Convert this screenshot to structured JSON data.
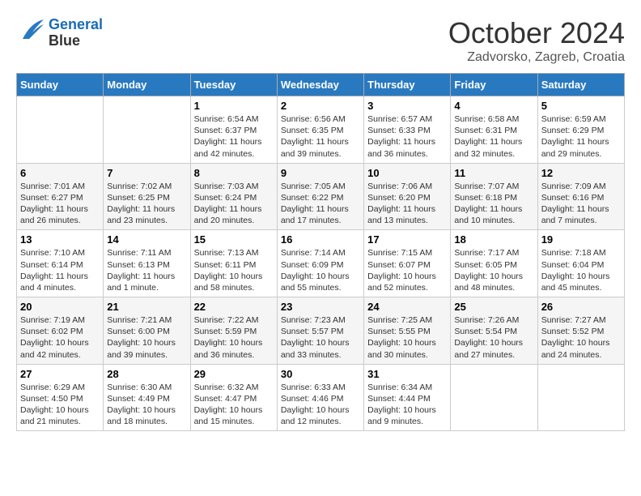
{
  "header": {
    "logo_line1": "General",
    "logo_line2": "Blue",
    "month": "October 2024",
    "location": "Zadvorsko, Zagreb, Croatia"
  },
  "weekdays": [
    "Sunday",
    "Monday",
    "Tuesday",
    "Wednesday",
    "Thursday",
    "Friday",
    "Saturday"
  ],
  "weeks": [
    [
      {
        "day": "",
        "info": ""
      },
      {
        "day": "",
        "info": ""
      },
      {
        "day": "1",
        "info": "Sunrise: 6:54 AM\nSunset: 6:37 PM\nDaylight: 11 hours\nand 42 minutes."
      },
      {
        "day": "2",
        "info": "Sunrise: 6:56 AM\nSunset: 6:35 PM\nDaylight: 11 hours\nand 39 minutes."
      },
      {
        "day": "3",
        "info": "Sunrise: 6:57 AM\nSunset: 6:33 PM\nDaylight: 11 hours\nand 36 minutes."
      },
      {
        "day": "4",
        "info": "Sunrise: 6:58 AM\nSunset: 6:31 PM\nDaylight: 11 hours\nand 32 minutes."
      },
      {
        "day": "5",
        "info": "Sunrise: 6:59 AM\nSunset: 6:29 PM\nDaylight: 11 hours\nand 29 minutes."
      }
    ],
    [
      {
        "day": "6",
        "info": "Sunrise: 7:01 AM\nSunset: 6:27 PM\nDaylight: 11 hours\nand 26 minutes."
      },
      {
        "day": "7",
        "info": "Sunrise: 7:02 AM\nSunset: 6:25 PM\nDaylight: 11 hours\nand 23 minutes."
      },
      {
        "day": "8",
        "info": "Sunrise: 7:03 AM\nSunset: 6:24 PM\nDaylight: 11 hours\nand 20 minutes."
      },
      {
        "day": "9",
        "info": "Sunrise: 7:05 AM\nSunset: 6:22 PM\nDaylight: 11 hours\nand 17 minutes."
      },
      {
        "day": "10",
        "info": "Sunrise: 7:06 AM\nSunset: 6:20 PM\nDaylight: 11 hours\nand 13 minutes."
      },
      {
        "day": "11",
        "info": "Sunrise: 7:07 AM\nSunset: 6:18 PM\nDaylight: 11 hours\nand 10 minutes."
      },
      {
        "day": "12",
        "info": "Sunrise: 7:09 AM\nSunset: 6:16 PM\nDaylight: 11 hours\nand 7 minutes."
      }
    ],
    [
      {
        "day": "13",
        "info": "Sunrise: 7:10 AM\nSunset: 6:14 PM\nDaylight: 11 hours\nand 4 minutes."
      },
      {
        "day": "14",
        "info": "Sunrise: 7:11 AM\nSunset: 6:13 PM\nDaylight: 11 hours\nand 1 minute."
      },
      {
        "day": "15",
        "info": "Sunrise: 7:13 AM\nSunset: 6:11 PM\nDaylight: 10 hours\nand 58 minutes."
      },
      {
        "day": "16",
        "info": "Sunrise: 7:14 AM\nSunset: 6:09 PM\nDaylight: 10 hours\nand 55 minutes."
      },
      {
        "day": "17",
        "info": "Sunrise: 7:15 AM\nSunset: 6:07 PM\nDaylight: 10 hours\nand 52 minutes."
      },
      {
        "day": "18",
        "info": "Sunrise: 7:17 AM\nSunset: 6:05 PM\nDaylight: 10 hours\nand 48 minutes."
      },
      {
        "day": "19",
        "info": "Sunrise: 7:18 AM\nSunset: 6:04 PM\nDaylight: 10 hours\nand 45 minutes."
      }
    ],
    [
      {
        "day": "20",
        "info": "Sunrise: 7:19 AM\nSunset: 6:02 PM\nDaylight: 10 hours\nand 42 minutes."
      },
      {
        "day": "21",
        "info": "Sunrise: 7:21 AM\nSunset: 6:00 PM\nDaylight: 10 hours\nand 39 minutes."
      },
      {
        "day": "22",
        "info": "Sunrise: 7:22 AM\nSunset: 5:59 PM\nDaylight: 10 hours\nand 36 minutes."
      },
      {
        "day": "23",
        "info": "Sunrise: 7:23 AM\nSunset: 5:57 PM\nDaylight: 10 hours\nand 33 minutes."
      },
      {
        "day": "24",
        "info": "Sunrise: 7:25 AM\nSunset: 5:55 PM\nDaylight: 10 hours\nand 30 minutes."
      },
      {
        "day": "25",
        "info": "Sunrise: 7:26 AM\nSunset: 5:54 PM\nDaylight: 10 hours\nand 27 minutes."
      },
      {
        "day": "26",
        "info": "Sunrise: 7:27 AM\nSunset: 5:52 PM\nDaylight: 10 hours\nand 24 minutes."
      }
    ],
    [
      {
        "day": "27",
        "info": "Sunrise: 6:29 AM\nSunset: 4:50 PM\nDaylight: 10 hours\nand 21 minutes."
      },
      {
        "day": "28",
        "info": "Sunrise: 6:30 AM\nSunset: 4:49 PM\nDaylight: 10 hours\nand 18 minutes."
      },
      {
        "day": "29",
        "info": "Sunrise: 6:32 AM\nSunset: 4:47 PM\nDaylight: 10 hours\nand 15 minutes."
      },
      {
        "day": "30",
        "info": "Sunrise: 6:33 AM\nSunset: 4:46 PM\nDaylight: 10 hours\nand 12 minutes."
      },
      {
        "day": "31",
        "info": "Sunrise: 6:34 AM\nSunset: 4:44 PM\nDaylight: 10 hours\nand 9 minutes."
      },
      {
        "day": "",
        "info": ""
      },
      {
        "day": "",
        "info": ""
      }
    ]
  ]
}
